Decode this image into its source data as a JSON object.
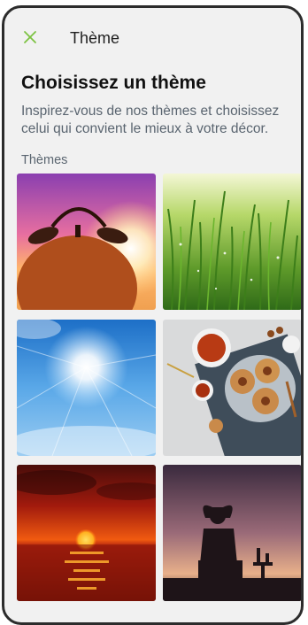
{
  "header": {
    "close_icon": "close-icon",
    "title": "Thème"
  },
  "main": {
    "heading": "Choisissez un thème",
    "description": "Inspirez-vous de nos thèmes et choisissez celui qui convient le mieux à votre décor.",
    "section_label": "Thèmes"
  },
  "themes": [
    {
      "name": "alarm-clock-sunrise"
    },
    {
      "name": "green-grass"
    },
    {
      "name": "blue-sky-sun"
    },
    {
      "name": "tea-and-cookies"
    },
    {
      "name": "sunset-over-sea"
    },
    {
      "name": "relaxing-person-silhouette"
    }
  ],
  "colors": {
    "accent": "#7cc242",
    "background": "#f1f1f1",
    "text_primary": "#111111",
    "text_secondary": "#5a6570"
  }
}
